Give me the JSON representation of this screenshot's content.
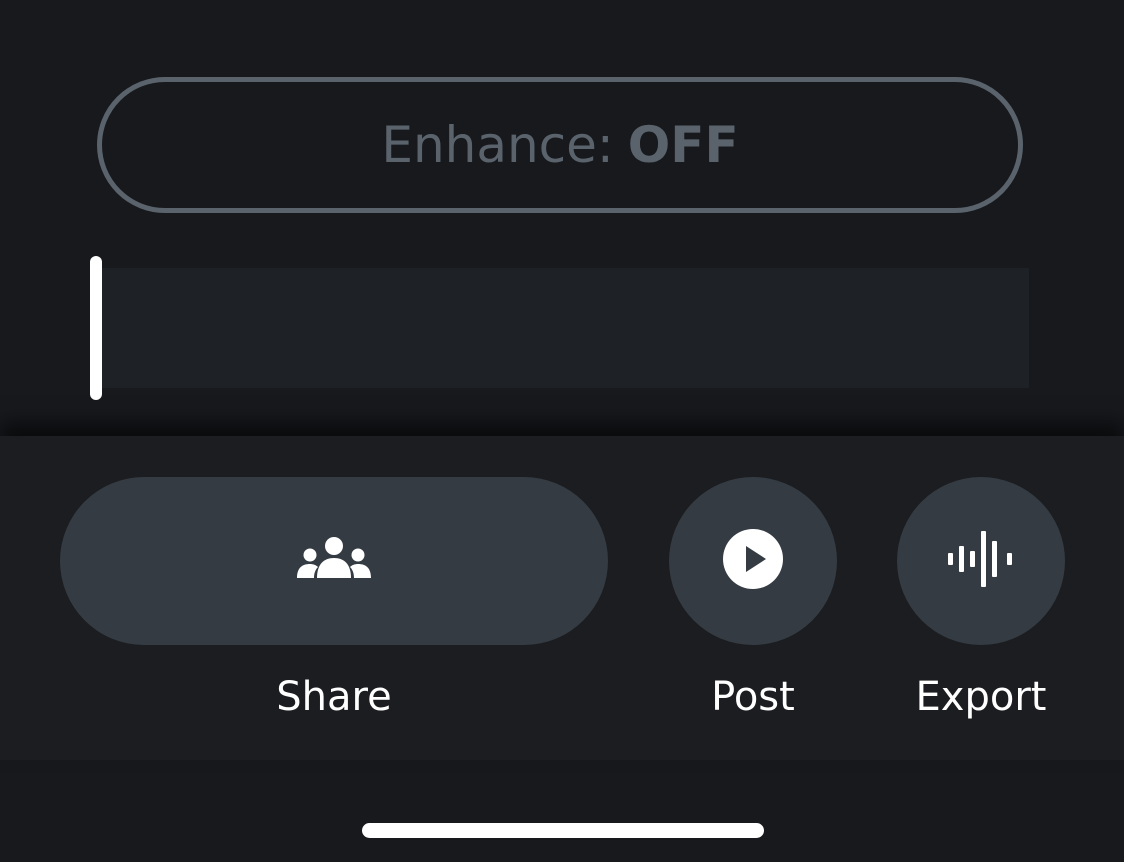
{
  "enhance": {
    "label": "Enhance:",
    "state": "OFF"
  },
  "actions": {
    "share": {
      "label": "Share",
      "icon": "people-group-icon"
    },
    "post": {
      "label": "Post",
      "icon": "play-circle-icon"
    },
    "export": {
      "label": "Export",
      "icon": "audio-waveform-icon"
    }
  },
  "colors": {
    "background": "#17191d",
    "panel": "#1b1d20",
    "button": "#343b43",
    "toggle_off": "#5a636c",
    "text": "#ffffff"
  }
}
